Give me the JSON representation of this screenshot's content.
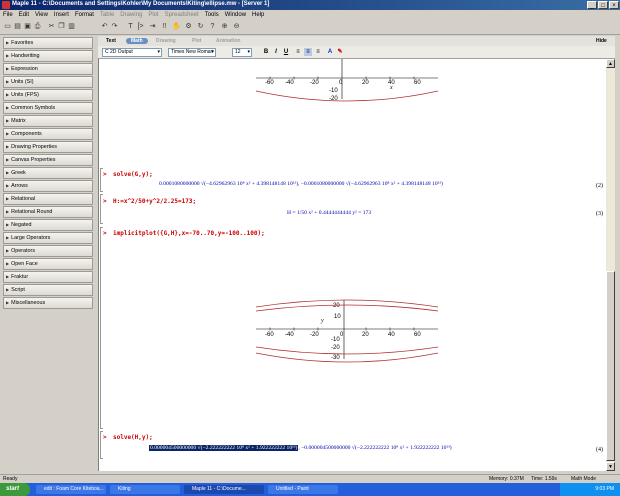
{
  "window": {
    "title": "Maple 11 - C:\\Documents and Settings\\Kohler\\My Documents\\Kiting\\ellipse.mw - [Server 1]"
  },
  "menu": [
    "File",
    "Edit",
    "View",
    "Insert",
    "Format",
    "Table",
    "Drawing",
    "Plot",
    "Spreadsheet",
    "Tools",
    "Window",
    "Help"
  ],
  "menu_disabled": [
    5,
    6,
    7,
    8
  ],
  "palettes": [
    "Favorites",
    "Handwriting",
    "Expression",
    "Units (SI)",
    "Units (FPS)",
    "Common Symbols",
    "Matrix",
    "Components",
    "Drawing Properties",
    "Canvas Properties",
    "Greek",
    "Arrows",
    "Relational",
    "Relational Round",
    "Negated",
    "Large Operators",
    "Operators",
    "Open Face",
    "Fraktur",
    "Script",
    "Miscellaneous"
  ],
  "context_tabs": {
    "text": "Text",
    "math": "Math",
    "drawing": "Drawing",
    "plot": "Plot",
    "animation": "Animation",
    "hide": "Hide"
  },
  "format_bar": {
    "style": "C  2D Output",
    "font": "Times New Roman",
    "size": "12"
  },
  "plot1": {
    "x_ticks": [
      "-60",
      "-40",
      "-20",
      "20",
      "40",
      "60"
    ],
    "y_ticks": [
      "-10",
      "-20"
    ],
    "x_label": "x",
    "zero": "0"
  },
  "cell1": {
    "cmd": "solve(G,y);",
    "output": "0.0001080000000 √(−4.62962963 10⁸ x² + 4.398148148 10¹²),  −0.0001080000000 √(−4.62962963 10⁸ x² + 4.398148148 10¹²)",
    "eqno": "(2)"
  },
  "cell2": {
    "cmd": "H:=x^2/50+y^2/2.25=173;",
    "output": "H = 1/50 x² + 0.4444444444 y² = 173",
    "eqno": "(3)"
  },
  "cell3": {
    "cmd": "implicitplot({G,H},x=-70..70,y=-100..100);"
  },
  "plot2": {
    "x_ticks": [
      "-60",
      "-40",
      "-20",
      "20",
      "40",
      "60"
    ],
    "y_ticks": [
      "20",
      "10",
      "-10",
      "-20",
      "-30"
    ],
    "y_label": "y",
    "zero": "0"
  },
  "cell4": {
    "cmd": "solve(H,y);",
    "output_hl": "0.000004500000000 √(−2.222222222 10⁸ x² + 1.922222222 10¹³)",
    "output_rest": ", −0.000004500000000 √(−2.222222222 10⁸ x² + 1.922222222 10¹³)",
    "eqno": "(4)"
  },
  "status": {
    "ready": "Ready",
    "memory": "Memory: 0.37M",
    "time": "Time: 1.59s",
    "mode": "Math Mode"
  },
  "taskbar": {
    "start": "start",
    "tasks": [
      "edit : Foam Core Kiteboa...",
      "Kiting",
      "Maple 11 - C:\\Docume...",
      "Untitled - Paint"
    ],
    "clock": "9:03 PM"
  },
  "colors": {
    "titlebar": "#0a246a",
    "prompt": "#cc0000",
    "output": "#0000aa",
    "curve": "#b03030",
    "selection": "#0a246a"
  }
}
